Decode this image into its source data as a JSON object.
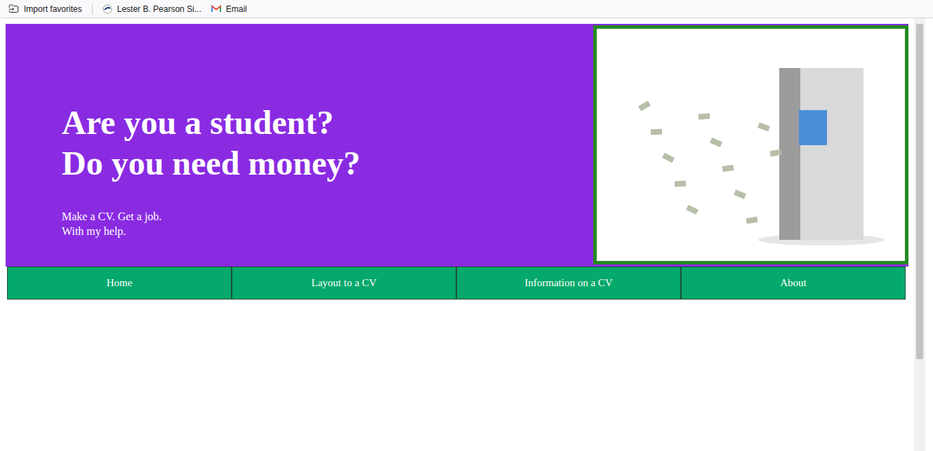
{
  "bookmarks": [
    {
      "label": "Import favorites"
    },
    {
      "label": "Lester B. Pearson Si..."
    },
    {
      "label": "Email"
    }
  ],
  "hero": {
    "headings": [
      "Are you a student?",
      "Do you need money?"
    ],
    "tagline": [
      "Make a CV. Get a job.",
      "With my help."
    ]
  },
  "nav": [
    {
      "label": "Home"
    },
    {
      "label": "Layout to a CV"
    },
    {
      "label": "Information on a CV"
    },
    {
      "label": "About"
    }
  ]
}
